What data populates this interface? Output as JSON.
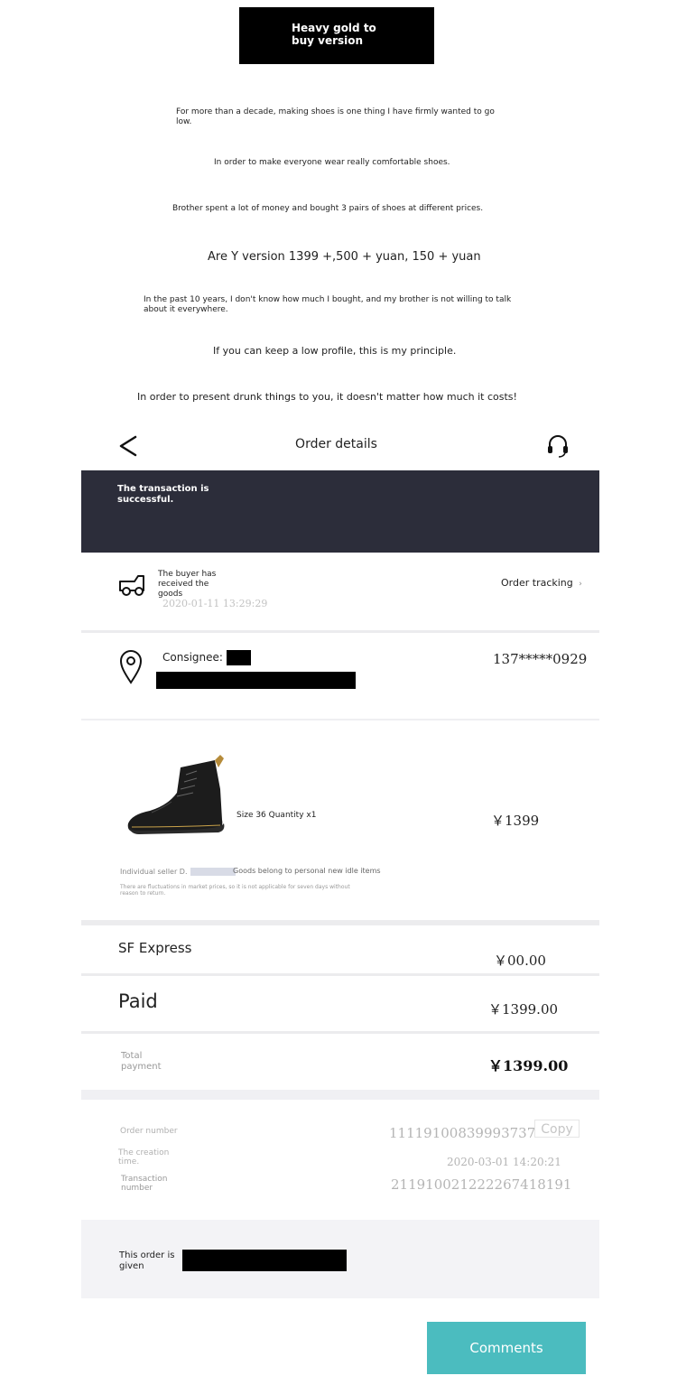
{
  "banner": {
    "text": "Heavy gold to buy version"
  },
  "story": [
    "For more than a decade, making shoes is one thing I have firmly wanted to go low.",
    "In order to make everyone wear really comfortable shoes.",
    "Brother spent a lot of money and bought 3 pairs of shoes at different prices.",
    "Are Y version 1399 +,500 + yuan, 150 + yuan",
    "In the past 10 years, I don't know how much I bought, and my brother is not willing to talk about it everywhere.",
    "If you can keep a low profile, this is my principle.",
    "In order to present drunk things to you, it doesn't matter how much it costs!"
  ],
  "nav": {
    "title": "Order details",
    "back_icon": "chevron-left-icon",
    "support_icon": "headset-icon"
  },
  "status": {
    "text": "The transaction is successful.",
    "bar_color": "#2c2d3a"
  },
  "delivery": {
    "icon": "truck-icon",
    "status": "The buyer has received the goods",
    "time": "2020-01-11   13:29:29",
    "tracking_label": "Order tracking",
    "tracking_chevron": "›"
  },
  "address": {
    "icon": "location-pin-icon",
    "consignee_label": "Consignee:",
    "phone": "137*****0929"
  },
  "product": {
    "spec": "Size 36 Quantity x1",
    "price": "￥1399",
    "seller_label": "Individual seller D.",
    "goods_note": "Goods belong to personal new idle items",
    "disclaimer": "There are fluctuations in market prices, so it is not applicable for seven days without reason to return."
  },
  "shipping": {
    "label": "SF Express",
    "amount": "￥00.00"
  },
  "paid": {
    "label": "Paid",
    "amount": "￥1399.00"
  },
  "total": {
    "label": "Total payment",
    "amount": "￥1399.00"
  },
  "order_info": {
    "order_number_label": "Order number",
    "order_number": "11119100839993737",
    "copy_label": "Copy",
    "creation_label": "The creation time.",
    "creation_time": "2020-03-01    14:20:21",
    "transaction_label": "Transaction number",
    "transaction_number": "211910021222267418191"
  },
  "given": {
    "text": "This order is given"
  },
  "comments_button": {
    "label": "Comments",
    "color": "#4bbcbf"
  }
}
